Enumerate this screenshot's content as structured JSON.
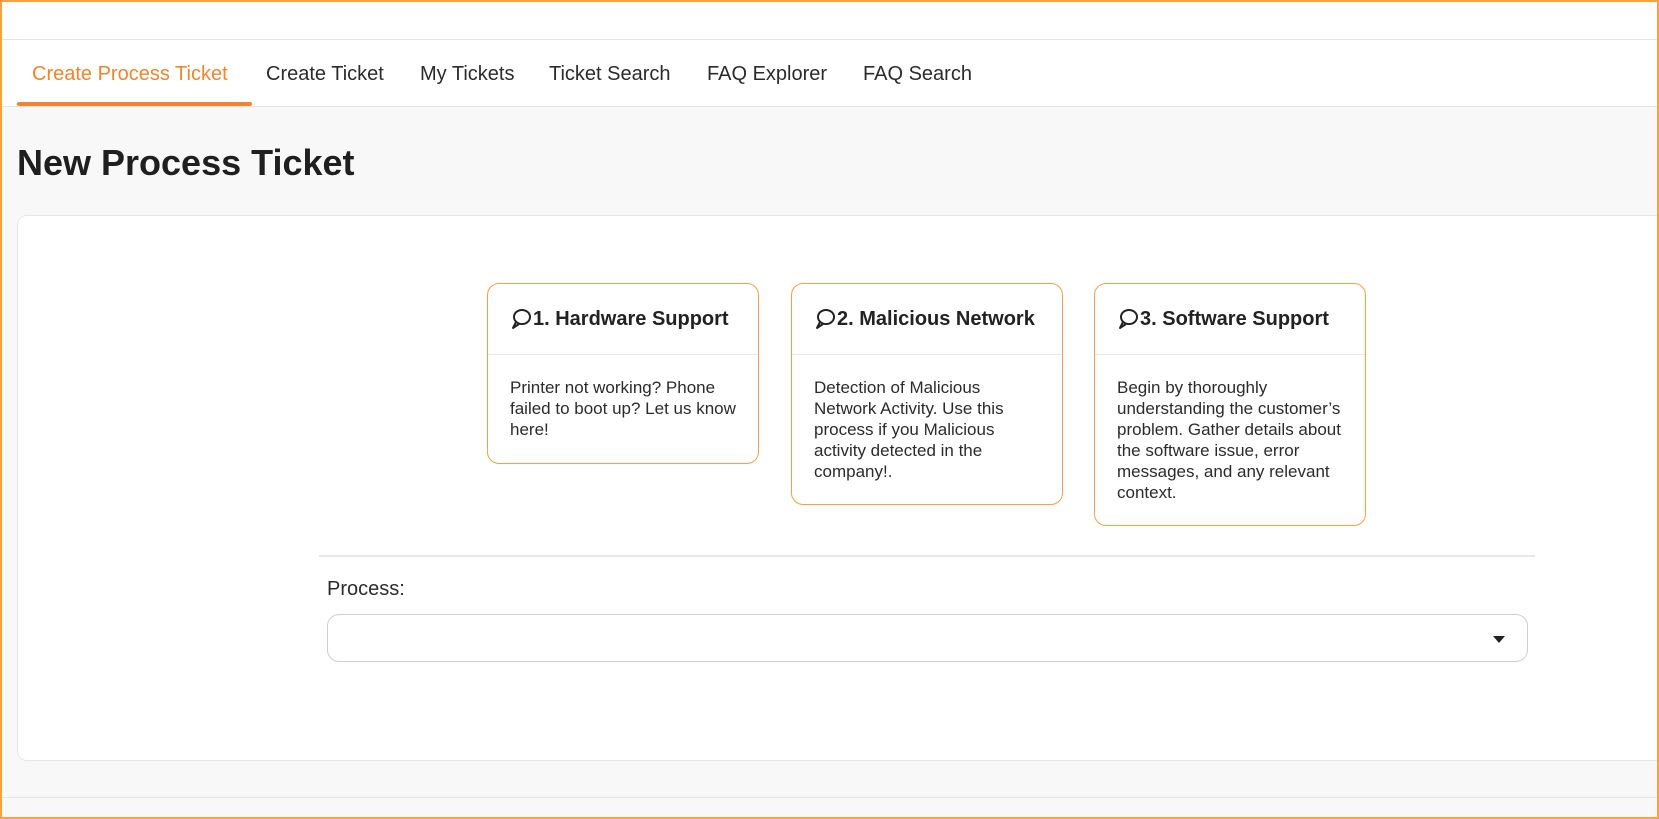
{
  "nav": {
    "tabs": [
      {
        "label": "Create Process Ticket",
        "active": true
      },
      {
        "label": "Create Ticket",
        "active": false
      },
      {
        "label": "My Tickets",
        "active": false
      },
      {
        "label": "Ticket Search",
        "active": false
      },
      {
        "label": "FAQ Explorer",
        "active": false
      },
      {
        "label": "FAQ Search",
        "active": false
      }
    ]
  },
  "main": {
    "title": "New Process Ticket",
    "cards": [
      {
        "icon": "chat-bubble-icon",
        "title": "1. Hardware Support",
        "description": "Printer not working? Phone failed to boot up? Let us know here!"
      },
      {
        "icon": "chat-bubble-icon",
        "title": "2. Malicious Network",
        "description": "Detection of Malicious Network Activity. Use this process if you Malicious activity detected in the company!."
      },
      {
        "icon": "chat-bubble-icon",
        "title": "3. Software Support",
        "description": "Begin by thoroughly understanding the customer’s problem. Gather details about the software issue, error messages, and any relevant context."
      }
    ],
    "process": {
      "label": "Process:",
      "selected": ""
    }
  },
  "colors": {
    "accent": "#f2842c",
    "card_border": "#f7a13f",
    "frame_border": "#f7a13f",
    "background": "#f8f8f8"
  }
}
